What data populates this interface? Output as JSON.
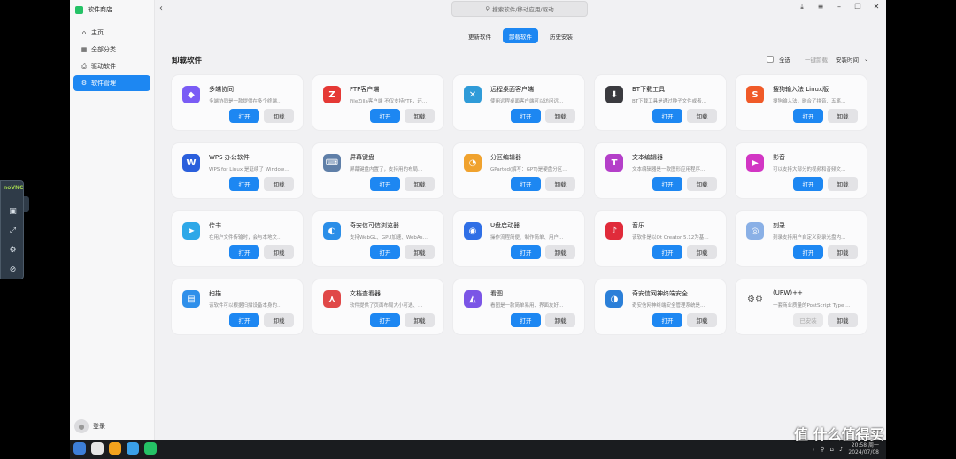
{
  "window": {
    "app_title": "软件商店"
  },
  "sidebar": {
    "items": [
      {
        "label": "主页",
        "icon": "home-icon",
        "glyph": "⌂"
      },
      {
        "label": "全部分类",
        "icon": "grid-icon",
        "glyph": "▦"
      },
      {
        "label": "驱动软件",
        "icon": "printer-icon",
        "glyph": "⎙"
      },
      {
        "label": "软件管理",
        "icon": "gear-icon",
        "glyph": "⚙"
      }
    ],
    "login_label": "登录"
  },
  "search": {
    "placeholder": "搜索软件/移动应用/驱动"
  },
  "tabs": [
    "更新软件",
    "卸载软件",
    "历史安装"
  ],
  "section": {
    "title": "卸载软件",
    "select_all": "全选",
    "one_click_uninstall": "一键卸载",
    "sort_label": "安装时间"
  },
  "buttons": {
    "open": "打开",
    "uninstall": "卸载",
    "installed": "已安装"
  },
  "apps": [
    {
      "name": "多端协同",
      "desc": "多端协同是一款提供在多个终端…",
      "color": "#7a5cf5",
      "glyph": "◆"
    },
    {
      "name": "FTP客户端",
      "desc": "FileZilla客户端 不仅支持FTP，还…",
      "color": "#e53935",
      "glyph": "Z"
    },
    {
      "name": "远程桌面客户端",
      "desc": "使用远程桌面客户端可以访问远…",
      "color": "#2f9bd8",
      "glyph": "✕"
    },
    {
      "name": "BT下载工具",
      "desc": "BT下载工具是通过种子文件或者…",
      "color": "#3a3a3f",
      "glyph": "⬇"
    },
    {
      "name": "搜狗输入法 Linux版",
      "desc": "搜狗输入法，融合了拼音、五笔…",
      "color": "#f05a28",
      "glyph": "S"
    },
    {
      "name": "WPS 办公软件",
      "desc": "WPS for Linux 是延续了 Window…",
      "color": "#2b5fdc",
      "glyph": "W"
    },
    {
      "name": "屏幕键盘",
      "desc": "屏幕键盘内置了，支持用的布局…",
      "color": "#5f7fa8",
      "glyph": "⌨"
    },
    {
      "name": "分区编辑器",
      "desc": "GParted(解写：GPT)是硬盘分区…",
      "color": "#f0a22e",
      "glyph": "◔"
    },
    {
      "name": "文本编辑器",
      "desc": "文本编辑器是一款图形应用程序…",
      "color": "#b43fc9",
      "glyph": "T"
    },
    {
      "name": "影音",
      "desc": "可以支持大部分的视频和音频文…",
      "color": "#d236c4",
      "glyph": "▶"
    },
    {
      "name": "传书",
      "desc": "在用户文件传输时，会与本地文…",
      "color": "#2ea8e8",
      "glyph": "➤"
    },
    {
      "name": "奇安信可信浏览器",
      "desc": "支持WebGL、GPU加速、WebAs…",
      "color": "#2b8ee8",
      "glyph": "◐"
    },
    {
      "name": "U盘启动器",
      "desc": "操作流程简便、制作简单、用户…",
      "color": "#2f6fe6",
      "glyph": "◉"
    },
    {
      "name": "音乐",
      "desc": "该软件是以Qt Creator 5.12为基…",
      "color": "#e02b3a",
      "glyph": "♪"
    },
    {
      "name": "刻录",
      "desc": "刻录支持用户自定义刻录光盘内…",
      "color": "#8ab0e6",
      "glyph": "◎"
    },
    {
      "name": "扫描",
      "desc": "该软件可以根据扫描设备本身的…",
      "color": "#2f8fea",
      "glyph": "▤"
    },
    {
      "name": "文档查看器",
      "desc": "软件提供了页面布局大小可选、…",
      "color": "#e04848",
      "glyph": "⋏"
    },
    {
      "name": "看图",
      "desc": "看图是一款简单易用、界面友好…",
      "color": "#7b55e6",
      "glyph": "◭"
    },
    {
      "name": "奇安信网神终端安全…",
      "desc": "奇安信网神终端安全管理系统是…",
      "color": "#2b7fd8",
      "glyph": "◑"
    },
    {
      "name": "(URW)++",
      "desc": "一套商业质量的PostScript Type …",
      "color": "#555555",
      "glyph": "⚙⚙",
      "installed": true
    }
  ],
  "taskbar": {
    "time": "20:58 周一",
    "date": "2024/07/08"
  },
  "vnc": {
    "logo": "noVNC"
  },
  "watermark": "值 什么值得买"
}
